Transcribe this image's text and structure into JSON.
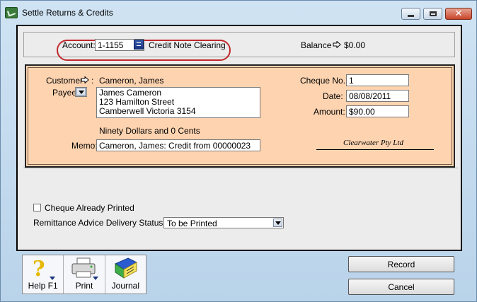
{
  "window": {
    "title": "Settle Returns & Credits"
  },
  "account": {
    "label": "Account:",
    "number": "1-1155",
    "name": "Credit Note Clearing",
    "balance_label": "Balance",
    "balance_value": "$0.00"
  },
  "cheque": {
    "customer_label": "Customer",
    "customer_value": "Cameron, James",
    "payee_label": "Payee",
    "payee_address": [
      "James Cameron",
      "123 Hamilton Street",
      "Camberwell  Victoria  3154"
    ],
    "amount_words": "Ninety Dollars and 0 Cents",
    "memo_label": "Memo:",
    "memo_value": "Cameron, James:  Credit from 00000023",
    "cheque_no_label": "Cheque No.:",
    "cheque_no_value": "1",
    "date_label": "Date:",
    "date_value": "08/08/2011",
    "amount_label": "Amount:",
    "amount_value": "$90.00",
    "signature": "Clearwater Pty Ltd"
  },
  "options": {
    "cheque_printed_label": "Cheque Already Printed",
    "remittance_label": "Remittance Advice Delivery Status:",
    "remittance_value": "To be Printed"
  },
  "toolbar": {
    "help_label": "Help F1",
    "print_label": "Print",
    "journal_label": "Journal"
  },
  "buttons": {
    "record_label": "Record",
    "cancel_label": "Cancel"
  },
  "colors": {
    "cheque_bg": "#fdd3b0",
    "highlight_oval": "#c0282d"
  }
}
